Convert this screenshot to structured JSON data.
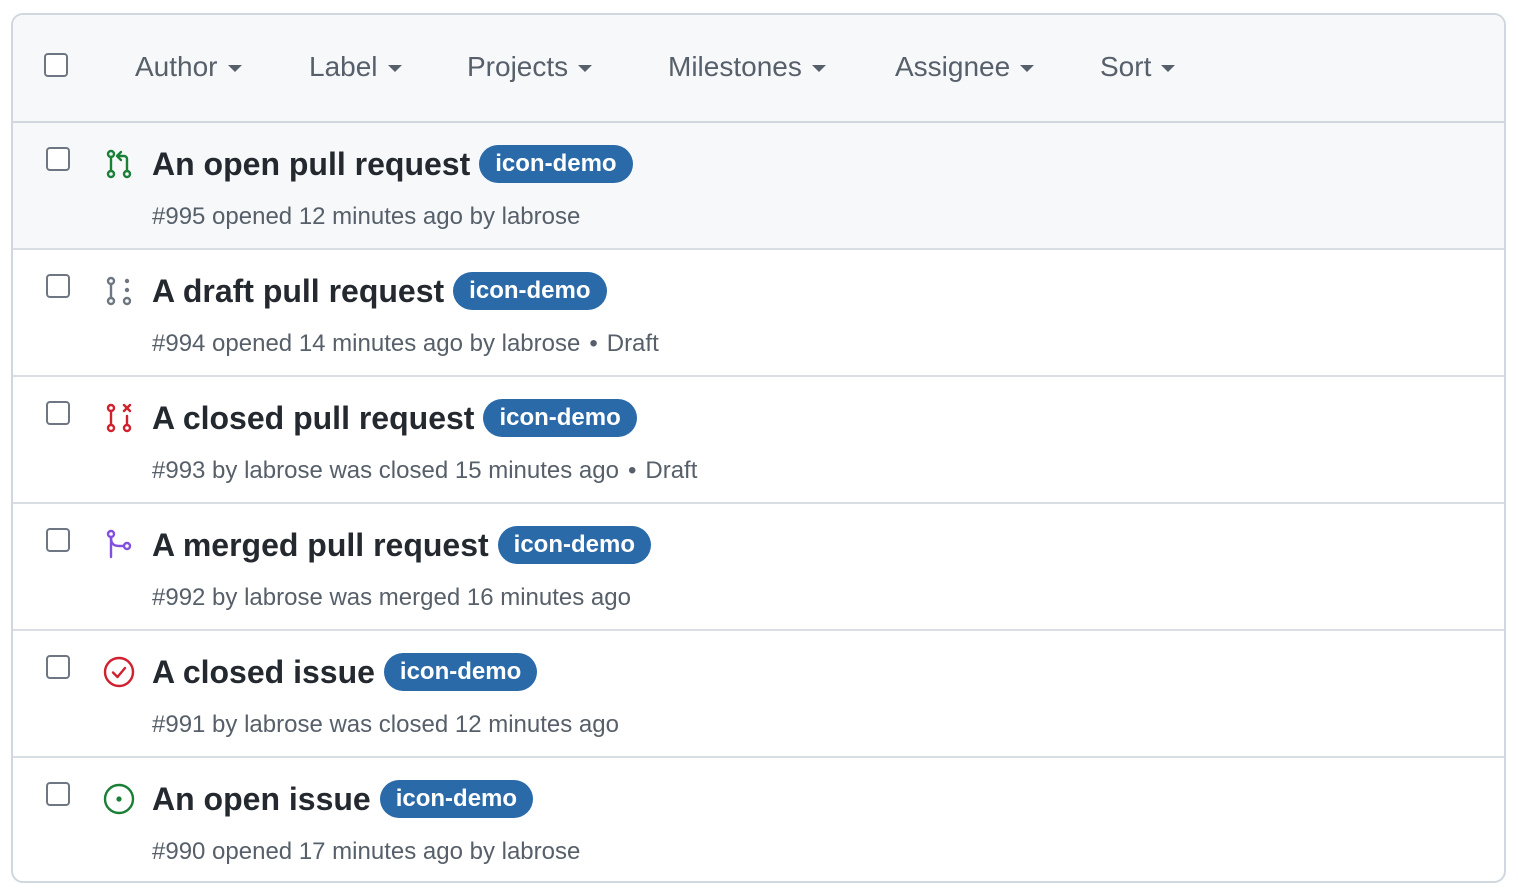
{
  "filters": {
    "author": "Author",
    "label": "Label",
    "projects": "Projects",
    "milestones": "Milestones",
    "assignee": "Assignee",
    "sort": "Sort"
  },
  "items": [
    {
      "title": "An open pull request",
      "label": "icon-demo",
      "meta": "#995 opened 12 minutes ago by labrose",
      "extra": "",
      "icon": "git-pull-request-icon",
      "icon_color": "#1a7f37"
    },
    {
      "title": "A draft pull request",
      "label": "icon-demo",
      "meta": "#994 opened 14 minutes ago by labrose",
      "extra": "Draft",
      "icon": "git-pull-request-draft-icon",
      "icon_color": "#6e7781"
    },
    {
      "title": "A closed pull request",
      "label": "icon-demo",
      "meta": "#993 by labrose was closed 15 minutes ago",
      "extra": "Draft",
      "icon": "git-pull-request-closed-icon",
      "icon_color": "#cf222e"
    },
    {
      "title": "A merged pull request",
      "label": "icon-demo",
      "meta": "#992 by labrose was merged 16 minutes ago",
      "extra": "",
      "icon": "git-merge-icon",
      "icon_color": "#8250df"
    },
    {
      "title": "A closed issue",
      "label": "icon-demo",
      "meta": "#991 by labrose was closed 12 minutes ago",
      "extra": "",
      "icon": "issue-closed-icon",
      "icon_color": "#cf222e"
    },
    {
      "title": "An open issue",
      "label": "icon-demo",
      "meta": "#990 opened 17 minutes ago by labrose",
      "extra": "",
      "icon": "issue-opened-icon",
      "icon_color": "#1a7f37"
    }
  ],
  "separator": "•",
  "colors": {
    "label_bg": "#2b6aa8",
    "header_bg": "#f6f8fa",
    "border": "#d0d7de"
  }
}
